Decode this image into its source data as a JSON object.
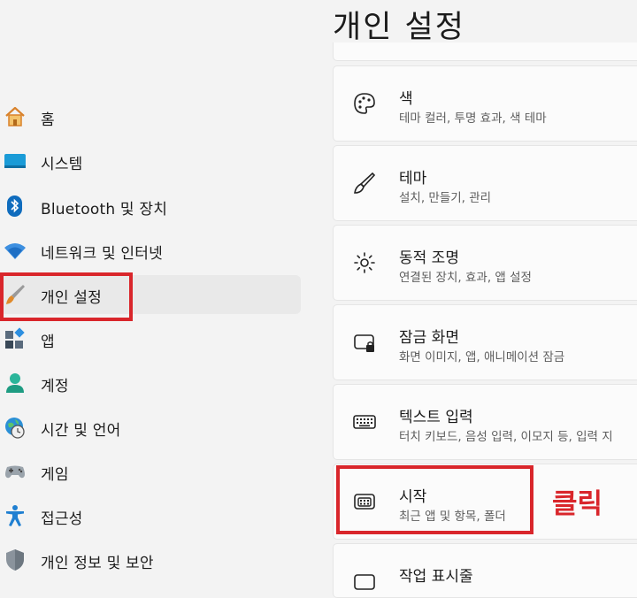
{
  "header": {
    "title": "개인 설정"
  },
  "sidebar": {
    "items": [
      {
        "label": "홈",
        "icon": "home-icon"
      },
      {
        "label": "시스템",
        "icon": "system-icon"
      },
      {
        "label": "Bluetooth 및 장치",
        "icon": "bluetooth-icon"
      },
      {
        "label": "네트워크 및 인터넷",
        "icon": "wifi-icon"
      },
      {
        "label": "개인 설정",
        "icon": "brush-icon",
        "selected": true
      },
      {
        "label": "앱",
        "icon": "apps-icon"
      },
      {
        "label": "계정",
        "icon": "account-icon"
      },
      {
        "label": "시간 및 언어",
        "icon": "globe-clock-icon"
      },
      {
        "label": "게임",
        "icon": "gamepad-icon"
      },
      {
        "label": "접근성",
        "icon": "accessibility-icon"
      },
      {
        "label": "개인 정보 및 보안",
        "icon": "shield-icon"
      }
    ]
  },
  "main": {
    "cards": [
      {
        "title": "색",
        "subtitle": "테마 컬러, 투명 효과, 색 테마",
        "icon": "palette-icon"
      },
      {
        "title": "테마",
        "subtitle": "설치, 만들기, 관리",
        "icon": "brush-icon"
      },
      {
        "title": "동적 조명",
        "subtitle": "연결된 장치, 효과, 앱 설정",
        "icon": "lighting-icon"
      },
      {
        "title": "잠금 화면",
        "subtitle": "화면 이미지, 앱, 애니메이션 잠금",
        "icon": "lock-screen-icon"
      },
      {
        "title": "텍스트 입력",
        "subtitle": "터치 키보드, 음성 입력, 이모지 등, 입력 지",
        "icon": "keyboard-icon"
      },
      {
        "title": "시작",
        "subtitle": "최근 앱 및 항목, 폴더",
        "icon": "start-icon"
      },
      {
        "title": "작업 표시줄",
        "icon": "taskbar-icon"
      }
    ]
  },
  "annotation": {
    "text": "클릭",
    "color": "#d9262b"
  },
  "colors": {
    "accent": "#0067c0",
    "highlight": "#d9262b",
    "background": "#f3f3f3"
  }
}
